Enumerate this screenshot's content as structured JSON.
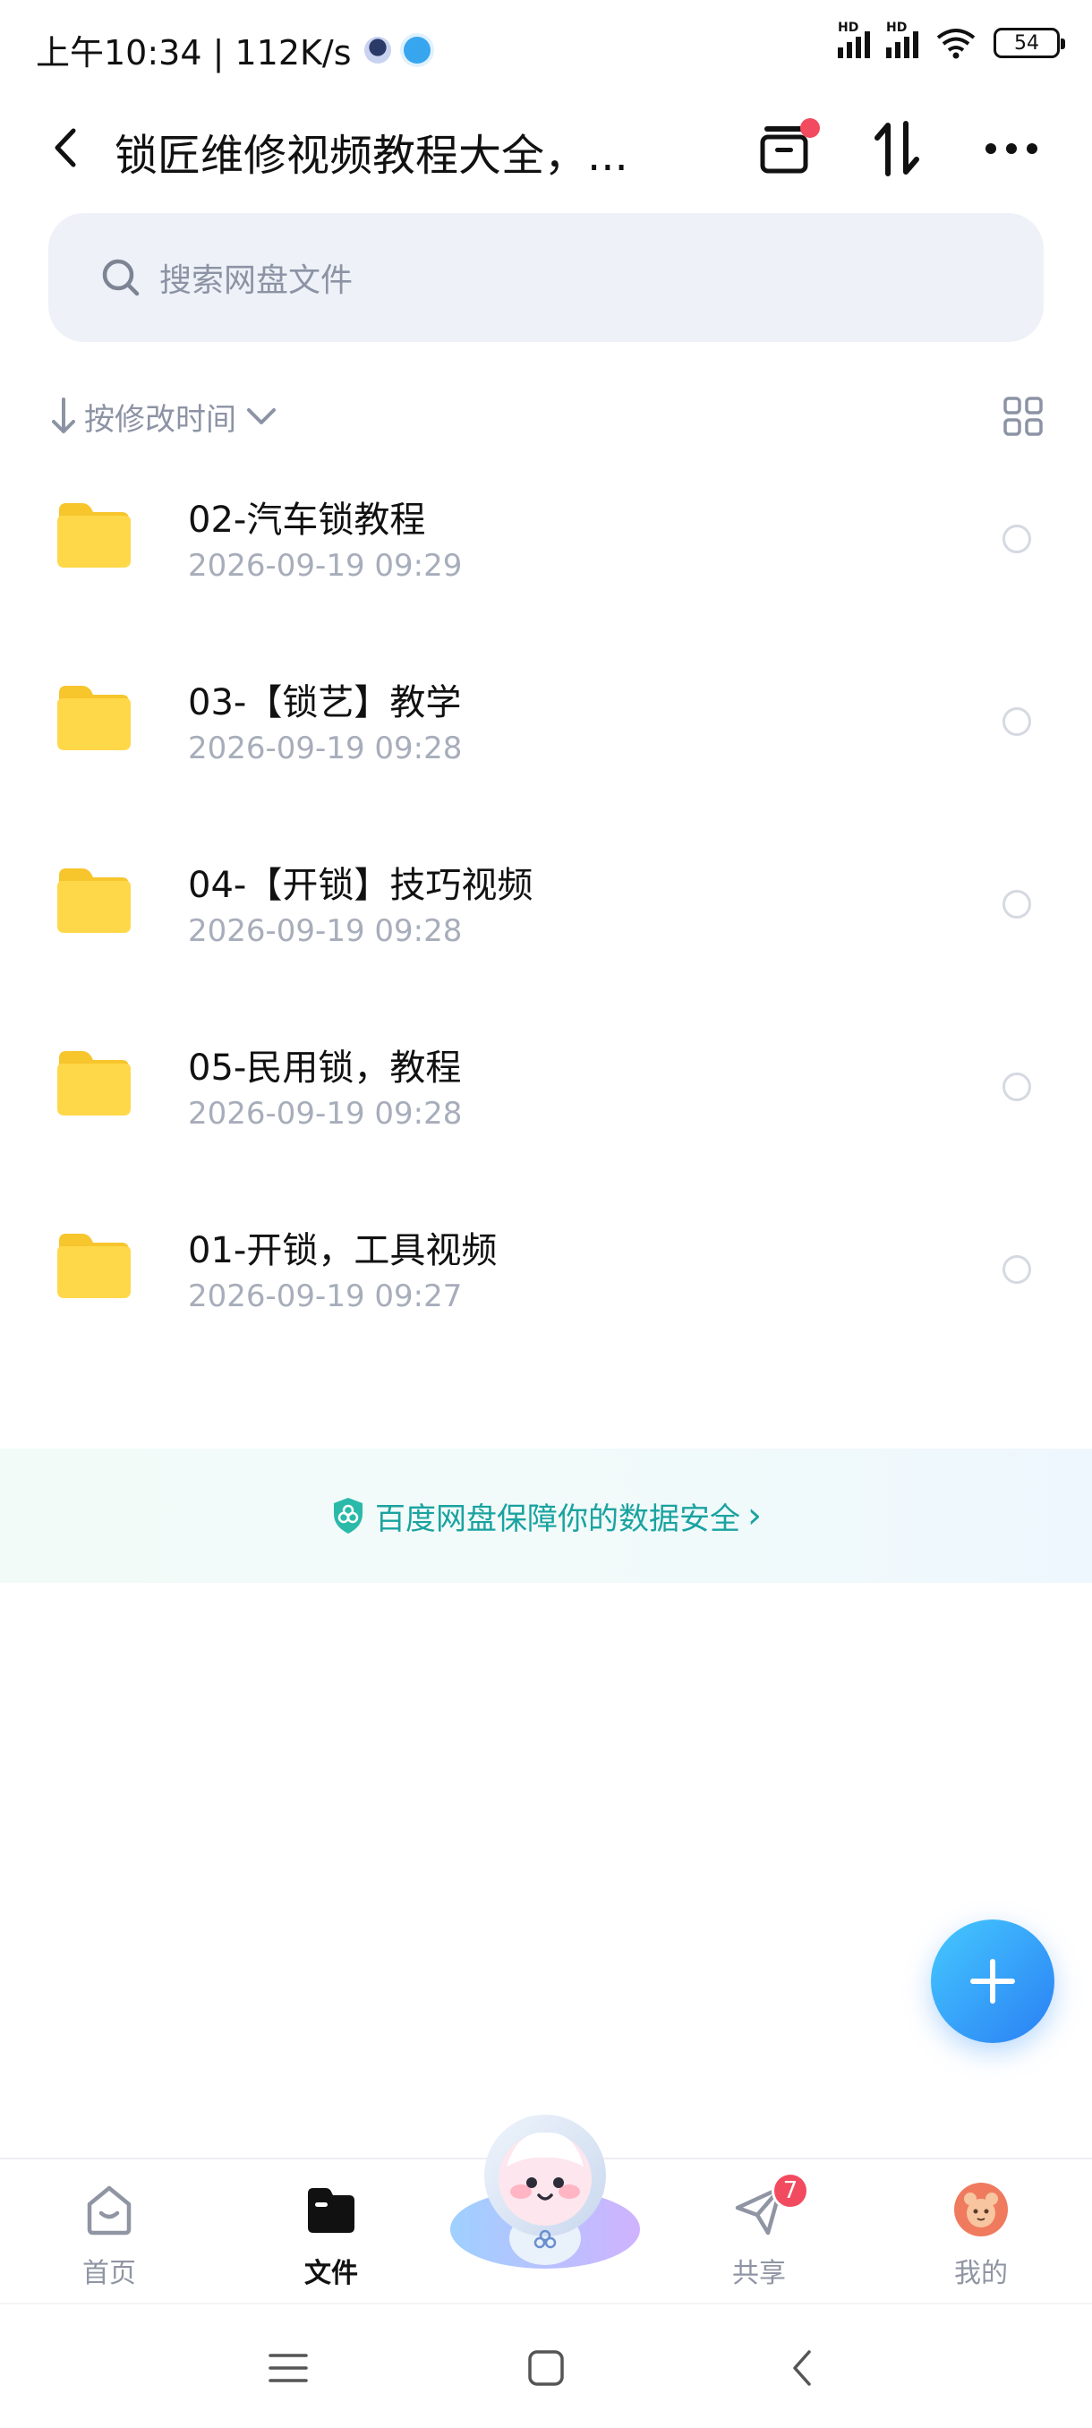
{
  "status_bar": {
    "time_speed": "上午10:34 | 112K/s",
    "network_label": "HD",
    "battery": "54"
  },
  "header": {
    "title": "锁匠维修视频教程大全，...",
    "icons": [
      "back-icon",
      "transfer-list-icon",
      "sort-icon",
      "more-icon"
    ]
  },
  "search": {
    "placeholder": "搜索网盘文件"
  },
  "sort": {
    "label": "按修改时间"
  },
  "files": [
    {
      "name": "02-汽车锁教程",
      "date": "2026-09-19  09:29"
    },
    {
      "name": "03-【锁艺】教学",
      "date": "2026-09-19  09:28"
    },
    {
      "name": "04-【开锁】技巧视频",
      "date": "2026-09-19  09:28"
    },
    {
      "name": "05-民用锁，教程",
      "date": "2026-09-19  09:28"
    },
    {
      "name": "01-开锁，工具视频",
      "date": "2026-09-19  09:27"
    }
  ],
  "security_banner": {
    "text": "百度网盘保障你的数据安全"
  },
  "tabs": [
    {
      "label": "首页",
      "icon": "home-icon"
    },
    {
      "label": "文件",
      "icon": "folder-icon"
    },
    {
      "label": "共享",
      "icon": "share-icon",
      "badge": "7"
    },
    {
      "label": "我的",
      "icon": "profile-avatar-icon"
    }
  ],
  "colors": {
    "accent": "#2a7ff4",
    "folder": "#ffd43b",
    "badge": "#f24b5f",
    "security": "#1aa3a0"
  }
}
